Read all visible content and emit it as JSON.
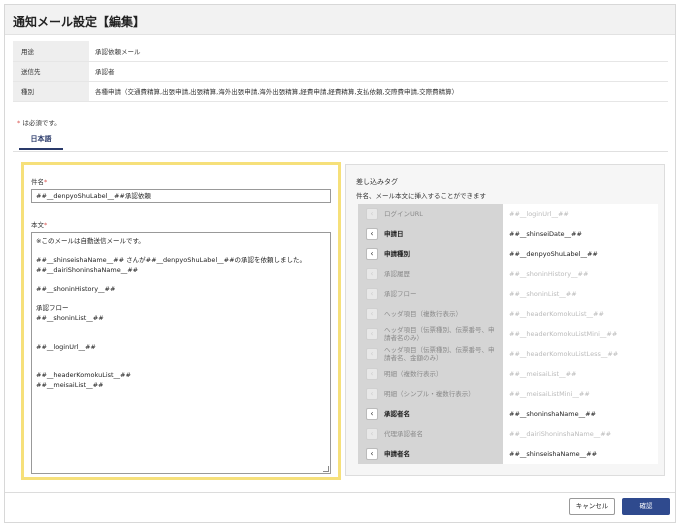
{
  "page": {
    "title": "通知メール設定【編集】",
    "required_mark": "*",
    "required_note": "は必須です。"
  },
  "info": [
    {
      "label": "用途",
      "value": "承認依頼メール"
    },
    {
      "label": "送信先",
      "value": "承認者"
    },
    {
      "label": "種別",
      "value": "各種申請（交通費精算,出張申請,出張精算,海外出張申請,海外出張精算,経費申請,経費精算,支払依頼,交際費申請,交際費精算）"
    }
  ],
  "tabs": [
    {
      "label": "日本語"
    }
  ],
  "form": {
    "subject_label": "件名",
    "subject_value": "##__denpyoShuLabel__##承認依頼",
    "body_label": "本文",
    "body_value": "※このメールは自動送信メールです。\n\n##__shinseishaName__## さんが##__denpyoShuLabel__##の承認を依頼しました。\n##__dairiShoninshaName__##\n\n##__shoninHistory__##\n\n承認フロー\n##__shoninList__##\n\n\n##__loginUrl__##\n\n\n##__headerKomokuList__##\n##__meisaiList__##"
  },
  "tags": {
    "title": "差し込みタグ",
    "description": "件名、メール本文に挿入することができます",
    "button_glyph": "‹",
    "rows": [
      {
        "label": "ログインURL",
        "tag": "##__loginUrl__##",
        "enabled": false
      },
      {
        "label": "申請日",
        "tag": "##__shinseiDate__##",
        "enabled": true
      },
      {
        "label": "申請種別",
        "tag": "##__denpyoShuLabel__##",
        "enabled": true
      },
      {
        "label": "承認履歴",
        "tag": "##__shoninHistory__##",
        "enabled": false
      },
      {
        "label": "承認フロー",
        "tag": "##__shoninList__##",
        "enabled": false
      },
      {
        "label": "ヘッダ項目（複数行表示）",
        "tag": "##__headerKomokuList__##",
        "enabled": false
      },
      {
        "label": "ヘッダ項目（伝票種別、伝票番号、申請者名のみ）",
        "tag": "##__headerKomokuListMini__##",
        "enabled": false
      },
      {
        "label": "ヘッダ項目（伝票種別、伝票番号、申請者名、金額のみ）",
        "tag": "##__headerKomokuListLess__##",
        "enabled": false
      },
      {
        "label": "明細（複数行表示）",
        "tag": "##__meisaiList__##",
        "enabled": false
      },
      {
        "label": "明細（シンプル・複数行表示）",
        "tag": "##__meisaiListMini__##",
        "enabled": false
      },
      {
        "label": "承認者名",
        "tag": "##__shoninshaName__##",
        "enabled": true
      },
      {
        "label": "代理承認者名",
        "tag": "##__dairiShoninshaName__##",
        "enabled": false
      },
      {
        "label": "申請者名",
        "tag": "##__shinseishaName__##",
        "enabled": true
      }
    ]
  },
  "footer": {
    "cancel_label": "キャンセル",
    "ok_label": "確認"
  },
  "colors": {
    "primary": "#2f4a8e",
    "highlight_border": "#f6e07a",
    "required": "#d9534f"
  }
}
